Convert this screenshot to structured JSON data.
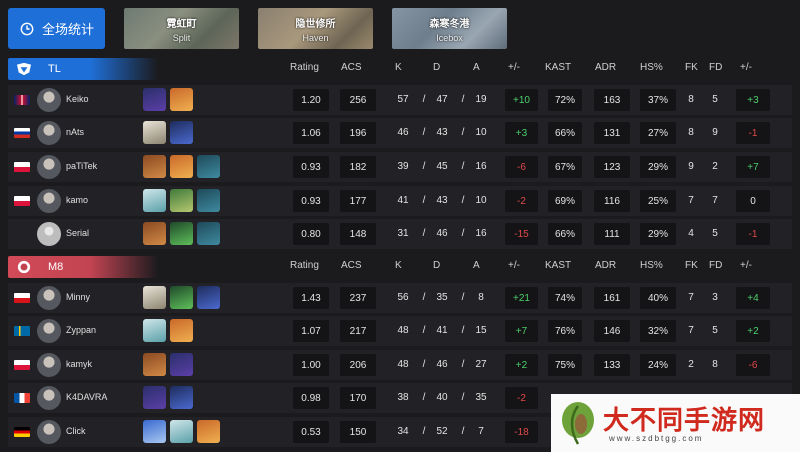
{
  "topbar": {
    "overall_label": "全场统计",
    "maps": [
      {
        "zh": "霓虹町",
        "en": "Split"
      },
      {
        "zh": "隐世修所",
        "en": "Haven"
      },
      {
        "zh": "森寒冬港",
        "en": "Icebox"
      }
    ]
  },
  "columns": [
    "Rating",
    "ACS",
    "K",
    "D",
    "A",
    "+/-",
    "KAST",
    "ADR",
    "HS%",
    "FK",
    "FD",
    "+/-"
  ],
  "colors": {
    "positive": "#4ccf6b",
    "negative": "#e04848",
    "tl": "#1f6fd8",
    "m8": "#d24a58"
  },
  "teams": [
    {
      "name": "TL",
      "players": [
        {
          "flag": "uk",
          "name": "Keiko",
          "agents": [
            "omen",
            "phoenix"
          ],
          "rating": "1.20",
          "acs": "256",
          "k": "57",
          "d": "47",
          "a": "19",
          "kd_diff": "+10",
          "kast": "72%",
          "adr": "163",
          "hs": "37%",
          "fk": "8",
          "fd": "5",
          "fk_diff": "+3"
        },
        {
          "flag": "ru",
          "name": "nAts",
          "agents": [
            "cypher",
            "yoru"
          ],
          "rating": "1.06",
          "acs": "196",
          "k": "46",
          "d": "43",
          "a": "10",
          "kd_diff": "+3",
          "kast": "66%",
          "adr": "131",
          "hs": "27%",
          "fk": "8",
          "fd": "9",
          "fk_diff": "-1"
        },
        {
          "flag": "pl",
          "name": "paTiTek",
          "agents": [
            "breach",
            "phoenix",
            "harbor"
          ],
          "rating": "0.93",
          "acs": "182",
          "k": "39",
          "d": "45",
          "a": "16",
          "kd_diff": "-6",
          "kast": "67%",
          "adr": "123",
          "hs": "29%",
          "fk": "9",
          "fd": "2",
          "fk_diff": "+7"
        },
        {
          "flag": "pl",
          "name": "kamo",
          "agents": [
            "sage",
            "skye",
            "harbor"
          ],
          "rating": "0.93",
          "acs": "177",
          "k": "41",
          "d": "43",
          "a": "10",
          "kd_diff": "-2",
          "kast": "69%",
          "adr": "116",
          "hs": "25%",
          "fk": "7",
          "fd": "7",
          "fk_diff": "0"
        },
        {
          "flag": "",
          "name": "Serial",
          "agents": [
            "breach",
            "viper",
            "harbor"
          ],
          "rating": "0.80",
          "acs": "148",
          "k": "31",
          "d": "46",
          "a": "16",
          "kd_diff": "-15",
          "kast": "66%",
          "adr": "111",
          "hs": "29%",
          "fk": "4",
          "fd": "5",
          "fk_diff": "-1"
        }
      ]
    },
    {
      "name": "M8",
      "players": [
        {
          "flag": "cz",
          "name": "Minny",
          "agents": [
            "cypher",
            "viper",
            "yoru"
          ],
          "rating": "1.43",
          "acs": "237",
          "k": "56",
          "d": "35",
          "a": "8",
          "kd_diff": "+21",
          "kast": "74%",
          "adr": "161",
          "hs": "40%",
          "fk": "7",
          "fd": "3",
          "fk_diff": "+4"
        },
        {
          "flag": "se",
          "name": "Zyppan",
          "agents": [
            "sage",
            "phoenix"
          ],
          "rating": "1.07",
          "acs": "217",
          "k": "48",
          "d": "41",
          "a": "15",
          "kd_diff": "+7",
          "kast": "76%",
          "adr": "146",
          "hs": "32%",
          "fk": "7",
          "fd": "5",
          "fk_diff": "+2"
        },
        {
          "flag": "pl",
          "name": "kamyk",
          "agents": [
            "breach",
            "omen"
          ],
          "rating": "1.00",
          "acs": "206",
          "k": "48",
          "d": "46",
          "a": "27",
          "kd_diff": "+2",
          "kast": "75%",
          "adr": "133",
          "hs": "24%",
          "fk": "2",
          "fd": "8",
          "fk_diff": "-6"
        },
        {
          "flag": "fr",
          "name": "K4DAVRA",
          "agents": [
            "omen",
            "yoru"
          ],
          "rating": "0.98",
          "acs": "170",
          "k": "38",
          "d": "40",
          "a": "35",
          "kd_diff": "-2",
          "kast": "",
          "adr": "",
          "hs": "",
          "fk": "",
          "fd": "",
          "fk_diff": ""
        },
        {
          "flag": "de",
          "name": "Click",
          "agents": [
            "jett",
            "sage",
            "phoenix"
          ],
          "rating": "0.53",
          "acs": "150",
          "k": "34",
          "d": "52",
          "a": "7",
          "kd_diff": "-18",
          "kast": "",
          "adr": "",
          "hs": "",
          "fk": "",
          "fd": "",
          "fk_diff": ""
        }
      ]
    }
  ],
  "watermark": {
    "text": "大不同手游网",
    "url": "www.szdbtgg.com"
  }
}
